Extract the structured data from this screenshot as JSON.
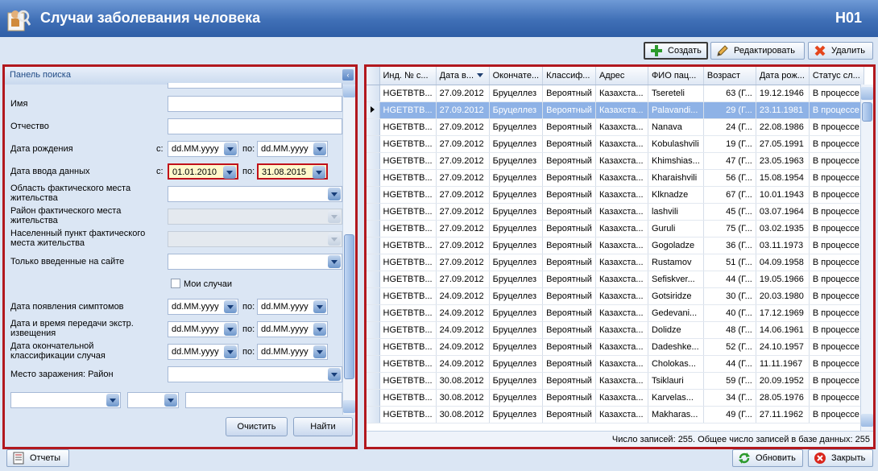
{
  "window": {
    "title": "Случаи заболевания человека",
    "code": "H01"
  },
  "toolbar": {
    "create": "Создать",
    "edit": "Редактировать",
    "delete": "Удалить"
  },
  "search": {
    "header": "Панель поиска",
    "labels": {
      "name": "Имя",
      "patronymic": "Отчество",
      "birth_date": "Дата рождения",
      "entry_date": "Дата ввода данных",
      "region": "Область фактического места жительства",
      "district": "Район фактического места жительства",
      "settlement": "Населенный пункт фактического места жительства",
      "site_only": "Только введенные на сайте",
      "my_cases": "Мои случаи",
      "symptom_date": "Дата появления симптомов",
      "notify_date": "Дата и время передачи экстр. извещения",
      "final_class_date": "Дата окончательной классификации случая",
      "infection_district": "Место заражения: Район",
      "from": "с:",
      "to": "по:"
    },
    "date_placeholder": "dd.MM.yyyy",
    "entry_from": "01.01.2010",
    "entry_to": "31.08.2015",
    "clear": "Очистить",
    "find": "Найти"
  },
  "grid": {
    "columns": [
      "Инд. № с...",
      "Дата в...",
      "Окончате...",
      "Классиф...",
      "Адрес",
      "ФИО пац...",
      "Возраст",
      "Дата рож...",
      "Статус сл..."
    ],
    "rows": [
      [
        "HGETBTB...",
        "27.09.2012",
        "Бруцеллез",
        "Вероятный",
        "Казахста...",
        "Tsereteli",
        "63 (Г...",
        "19.12.1946",
        "В процессе"
      ],
      [
        "HGETBTB...",
        "27.09.2012",
        "Бруцеллез",
        "Вероятный",
        "Казахста...",
        "Palavandi...",
        "29 (Г...",
        "23.11.1981",
        "В процессе"
      ],
      [
        "HGETBTB...",
        "27.09.2012",
        "Бруцеллез",
        "Вероятный",
        "Казахста...",
        "Nanava",
        "24 (Г...",
        "22.08.1986",
        "В процессе"
      ],
      [
        "HGETBTB...",
        "27.09.2012",
        "Бруцеллез",
        "Вероятный",
        "Казахста...",
        "Kobulashvili",
        "19 (Г...",
        "27.05.1991",
        "В процессе"
      ],
      [
        "HGETBTB...",
        "27.09.2012",
        "Бруцеллез",
        "Вероятный",
        "Казахста...",
        "Khimshias...",
        "47 (Г...",
        "23.05.1963",
        "В процессе"
      ],
      [
        "HGETBTB...",
        "27.09.2012",
        "Бруцеллез",
        "Вероятный",
        "Казахста...",
        "Kharaishvili",
        "56 (Г...",
        "15.08.1954",
        "В процессе"
      ],
      [
        "HGETBTB...",
        "27.09.2012",
        "Бруцеллез",
        "Вероятный",
        "Казахста...",
        "Klknadze",
        "67 (Г...",
        "10.01.1943",
        "В процессе"
      ],
      [
        "HGETBTB...",
        "27.09.2012",
        "Бруцеллез",
        "Вероятный",
        "Казахста...",
        "lashvili",
        "45 (Г...",
        "03.07.1964",
        "В процессе"
      ],
      [
        "HGETBTB...",
        "27.09.2012",
        "Бруцеллез",
        "Вероятный",
        "Казахста...",
        "Guruli",
        "75 (Г...",
        "03.02.1935",
        "В процессе"
      ],
      [
        "HGETBTB...",
        "27.09.2012",
        "Бруцеллез",
        "Вероятный",
        "Казахста...",
        "Gogoladze",
        "36 (Г...",
        "03.11.1973",
        "В процессе"
      ],
      [
        "HGETBTB...",
        "27.09.2012",
        "Бруцеллез",
        "Вероятный",
        "Казахста...",
        "Rustamov",
        "51 (Г...",
        "04.09.1958",
        "В процессе"
      ],
      [
        "HGETBTB...",
        "27.09.2012",
        "Бруцеллез",
        "Вероятный",
        "Казахста...",
        "Sefiskver...",
        "44 (Г...",
        "19.05.1966",
        "В процессе"
      ],
      [
        "HGETBTB...",
        "24.09.2012",
        "Бруцеллез",
        "Вероятный",
        "Казахста...",
        "Gotsiridze",
        "30 (Г...",
        "20.03.1980",
        "В процессе"
      ],
      [
        "HGETBTB...",
        "24.09.2012",
        "Бруцеллез",
        "Вероятный",
        "Казахста...",
        "Gedevani...",
        "40 (Г...",
        "17.12.1969",
        "В процессе"
      ],
      [
        "HGETBTB...",
        "24.09.2012",
        "Бруцеллез",
        "Вероятный",
        "Казахста...",
        "Dolidze",
        "48 (Г...",
        "14.06.1961",
        "В процессе"
      ],
      [
        "HGETBTB...",
        "24.09.2012",
        "Бруцеллез",
        "Вероятный",
        "Казахста...",
        "Dadeshke...",
        "52 (Г...",
        "24.10.1957",
        "В процессе"
      ],
      [
        "HGETBTB...",
        "24.09.2012",
        "Бруцеллез",
        "Вероятный",
        "Казахста...",
        "Cholokas...",
        "44 (Г...",
        "11.11.1967",
        "В процессе"
      ],
      [
        "HGETBTB...",
        "30.08.2012",
        "Бруцеллез",
        "Вероятный",
        "Казахста...",
        "Tsiklauri",
        "59 (Г...",
        "20.09.1952",
        "В процессе"
      ],
      [
        "HGETBTB...",
        "30.08.2012",
        "Бруцеллез",
        "Вероятный",
        "Казахста...",
        "Karvelas...",
        "34 (Г...",
        "28.05.1976",
        "В процессе"
      ],
      [
        "HGETBTB...",
        "30.08.2012",
        "Бруцеллез",
        "Вероятный",
        "Казахста...",
        "Makharas...",
        "49 (Г...",
        "27.11.1962",
        "В процессе"
      ]
    ],
    "footer": "Число записей: 255. Общее число записей в базе данных: 255"
  },
  "bottom": {
    "reports": "Отчеты",
    "refresh": "Обновить",
    "close": "Закрыть"
  },
  "colors": {
    "frame_red": "#b2181e",
    "selected_row": "#8eb2e6",
    "titlebar": "#3f6fb6"
  },
  "icons": [
    "user-search-icon",
    "plus-icon",
    "pencil-icon",
    "red-x-icon",
    "refresh-icon",
    "close-icon",
    "report-icon"
  ]
}
